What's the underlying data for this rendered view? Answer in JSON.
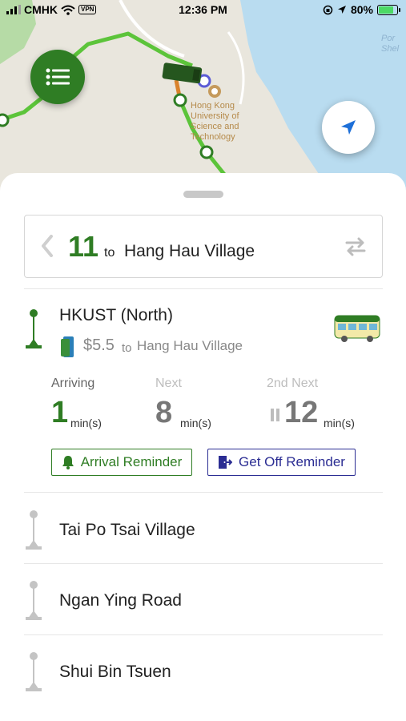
{
  "status_bar": {
    "carrier": "CMHK",
    "vpn": "VPN",
    "time": "12:36 PM",
    "battery": "80%",
    "battery_level": 0.8
  },
  "map": {
    "poi_label": "Hong Kong\nUniversity of\nScience and\nTechnology",
    "sea_label": "Por\nShel"
  },
  "route": {
    "number": "11",
    "to": "to",
    "destination": "Hang Hau Village"
  },
  "current_stop": {
    "name": "HKUST (North)",
    "fare": "$5.5",
    "fare_to": "to",
    "fare_destination": "Hang Hau Village"
  },
  "eta": [
    {
      "label": "Arriving",
      "value": "1",
      "unit": "min(s)"
    },
    {
      "label": "Next",
      "value": "8",
      "unit": "min(s)"
    },
    {
      "label": "2nd Next",
      "value": "12",
      "unit": "min(s)"
    }
  ],
  "buttons": {
    "arrival_reminder": "Arrival Reminder",
    "get_off_reminder": "Get Off Reminder"
  },
  "next_stops": [
    {
      "name": "Tai Po Tsai Village"
    },
    {
      "name": "Ngan Ying Road"
    },
    {
      "name": "Shui Bin Tsuen"
    }
  ],
  "colors": {
    "brand_green": "#2f7d24",
    "route_line": "#5cc43a",
    "reminder_blue": "#2b2d93",
    "eta_highlight": "#2f7d24",
    "eta_dim": "#777777",
    "map_sea": "#b9dcf0",
    "map_land": "#e9e6dd"
  },
  "icons": {
    "menu": "list-icon",
    "locate": "navigation-arrow-icon",
    "route_prev": "chevron-left-icon",
    "route_swap": "swap-arrows-icon",
    "bell": "bell-icon",
    "exit": "exit-door-icon",
    "bus": "minibus-icon",
    "stop_pin": "stop-pin-icon",
    "octopus": "octopus-card-icon"
  }
}
